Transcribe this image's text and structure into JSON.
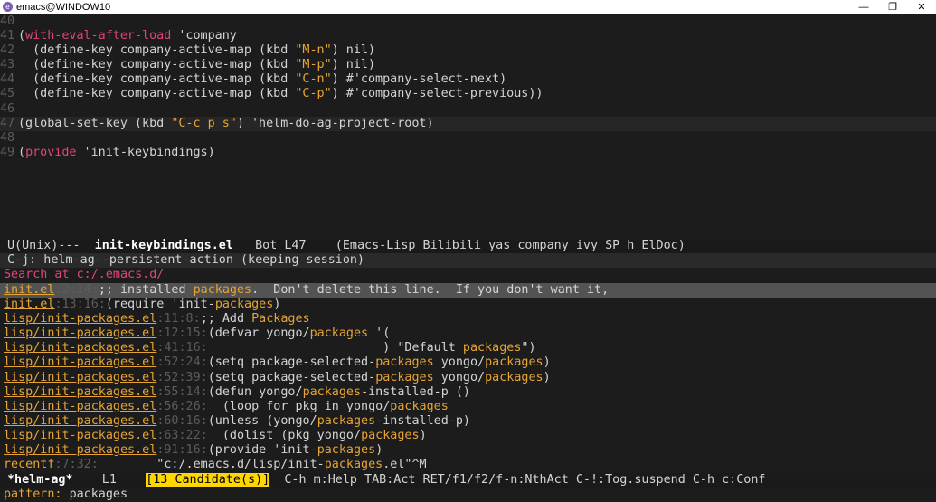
{
  "window": {
    "title": "emacs@WINDOW10",
    "min": "—",
    "max": "❐",
    "close": "✕"
  },
  "editor": {
    "lines": [
      {
        "n": "40",
        "segs": []
      },
      {
        "n": "41",
        "segs": [
          {
            "t": "(",
            "c": ""
          },
          {
            "t": "with-eval-after-load",
            "c": "kw"
          },
          {
            "t": " 'company",
            "c": ""
          }
        ]
      },
      {
        "n": "42",
        "segs": [
          {
            "t": "  (define-key company-active-map (kbd ",
            "c": ""
          },
          {
            "t": "\"M-n\"",
            "c": "str"
          },
          {
            "t": ") nil)",
            "c": ""
          }
        ]
      },
      {
        "n": "43",
        "segs": [
          {
            "t": "  (define-key company-active-map (kbd ",
            "c": ""
          },
          {
            "t": "\"M-p\"",
            "c": "str"
          },
          {
            "t": ") nil)",
            "c": ""
          }
        ]
      },
      {
        "n": "44",
        "segs": [
          {
            "t": "  (define-key company-active-map (kbd ",
            "c": ""
          },
          {
            "t": "\"C-n\"",
            "c": "str"
          },
          {
            "t": ") #'company-select-next)",
            "c": ""
          }
        ]
      },
      {
        "n": "45",
        "segs": [
          {
            "t": "  (define-key company-active-map (kbd ",
            "c": ""
          },
          {
            "t": "\"C-p\"",
            "c": "str"
          },
          {
            "t": ") #'company-select-previous))",
            "c": ""
          }
        ]
      },
      {
        "n": "46",
        "segs": []
      },
      {
        "n": "47",
        "hl": true,
        "segs": [
          {
            "t": "(global-set-key (kbd ",
            "c": ""
          },
          {
            "t": "\"C-c p s\"",
            "c": "str"
          },
          {
            "t": ") 'helm-do-ag-project-root)",
            "c": ""
          }
        ]
      },
      {
        "n": "48",
        "segs": []
      },
      {
        "n": "49",
        "segs": [
          {
            "t": "(",
            "c": ""
          },
          {
            "t": "provide",
            "c": "kw"
          },
          {
            "t": " 'init-keybindings)",
            "c": ""
          }
        ]
      }
    ]
  },
  "modeline": {
    "prefix": "U(Unix)---  ",
    "buffer": "init-keybindings.el",
    "rest": "   Bot L47    (Emacs-Lisp Bilibili yas company ivy SP h ElDoc)"
  },
  "helm": {
    "header": "C-j: helm-ag--persistent-action (keeping session)",
    "source": "Search at c:/.emacs.d/",
    "results": [
      {
        "sel": true,
        "file": "init.el",
        "loc": ":2:14:",
        "segs": [
          {
            "t": ";; installed ",
            "c": ""
          },
          {
            "t": "packages",
            "c": "match"
          },
          {
            "t": ".  Don't delete this line.  If you don't want it,",
            "c": ""
          }
        ]
      },
      {
        "file": "init.el",
        "loc": ":13:16:",
        "segs": [
          {
            "t": "(require 'init-",
            "c": ""
          },
          {
            "t": "packages",
            "c": "match"
          },
          {
            "t": ")",
            "c": ""
          }
        ]
      },
      {
        "file": "lisp/init-packages.el",
        "loc": ":11:8:",
        "segs": [
          {
            "t": ";; Add ",
            "c": ""
          },
          {
            "t": "Packages",
            "c": "match"
          }
        ]
      },
      {
        "file": "lisp/init-packages.el",
        "loc": ":12:15:",
        "segs": [
          {
            "t": "(defvar yongo/",
            "c": ""
          },
          {
            "t": "packages",
            "c": "match"
          },
          {
            "t": " '(",
            "c": ""
          }
        ]
      },
      {
        "file": "lisp/init-packages.el",
        "loc": ":41:16:",
        "segs": [
          {
            "t": "                        ) \"Default ",
            "c": ""
          },
          {
            "t": "packages",
            "c": "match"
          },
          {
            "t": "\")",
            "c": ""
          }
        ]
      },
      {
        "file": "lisp/init-packages.el",
        "loc": ":52:24:",
        "segs": [
          {
            "t": "(setq package-selected-",
            "c": ""
          },
          {
            "t": "packages",
            "c": "match"
          },
          {
            "t": " yongo/",
            "c": ""
          },
          {
            "t": "packages",
            "c": "match"
          },
          {
            "t": ")",
            "c": ""
          }
        ]
      },
      {
        "file": "lisp/init-packages.el",
        "loc": ":52:39:",
        "segs": [
          {
            "t": "(setq package-selected-",
            "c": ""
          },
          {
            "t": "packages",
            "c": "match"
          },
          {
            "t": " yongo/",
            "c": ""
          },
          {
            "t": "packages",
            "c": "match"
          },
          {
            "t": ")",
            "c": ""
          }
        ]
      },
      {
        "file": "lisp/init-packages.el",
        "loc": ":55:14:",
        "segs": [
          {
            "t": "(defun yongo/",
            "c": ""
          },
          {
            "t": "packages",
            "c": "match"
          },
          {
            "t": "-installed-p ()",
            "c": ""
          }
        ]
      },
      {
        "file": "lisp/init-packages.el",
        "loc": ":56:26:",
        "segs": [
          {
            "t": "  (loop for pkg in yongo/",
            "c": ""
          },
          {
            "t": "packages",
            "c": "match"
          }
        ]
      },
      {
        "file": "lisp/init-packages.el",
        "loc": ":60:16:",
        "segs": [
          {
            "t": "(unless (yongo/",
            "c": ""
          },
          {
            "t": "packages",
            "c": "match"
          },
          {
            "t": "-installed-p)",
            "c": ""
          }
        ]
      },
      {
        "file": "lisp/init-packages.el",
        "loc": ":63:22:",
        "segs": [
          {
            "t": "  (dolist (pkg yongo/",
            "c": ""
          },
          {
            "t": "packages",
            "c": "match"
          },
          {
            "t": ")",
            "c": ""
          }
        ]
      },
      {
        "file": "lisp/init-packages.el",
        "loc": ":91:16:",
        "segs": [
          {
            "t": "(provide 'init-",
            "c": ""
          },
          {
            "t": "packages",
            "c": "match"
          },
          {
            "t": ")",
            "c": ""
          }
        ]
      },
      {
        "file": "recentf",
        "loc": ":7:32:",
        "segs": [
          {
            "t": "        \"c:/.emacs.d/lisp/init-",
            "c": ""
          },
          {
            "t": "packages",
            "c": "match"
          },
          {
            "t": ".el\"^M",
            "c": ""
          }
        ]
      }
    ],
    "modeline": {
      "buffer": "*helm-ag*",
      "pos": "    L1    ",
      "candidates": "[13 Candidate(s)]",
      "keys": "  C-h m:Help TAB:Act RET/f1/f2/f-n:NthAct C-!:Tog.suspend C-h c:Conf"
    },
    "minibuffer": {
      "prompt": "pattern: ",
      "input": "packages"
    }
  }
}
